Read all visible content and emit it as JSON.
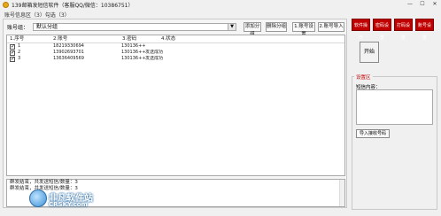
{
  "window": {
    "title": "139邮箱发短信软件（客服QQ/微信：10386751）",
    "controls": {
      "minimize": "—",
      "maximize": "☐",
      "close": "✕"
    }
  },
  "account_info": "账号信息区（3）勾选（3）",
  "account_toolbar": {
    "label": "账号组：",
    "selected_group": "默认分组",
    "buttons": [
      "添加分组",
      "删除分组",
      "1.账号设置",
      "2.账号导入"
    ]
  },
  "table": {
    "headers": [
      "1.序号",
      "2.账号",
      "3.密码",
      "4.状态"
    ],
    "rows": [
      {
        "num": "1",
        "account": "18219330694",
        "password": "130136++",
        "status": ""
      },
      {
        "num": "2",
        "account": "13902693701",
        "password": "130136++",
        "status": "发送成功"
      },
      {
        "num": "3",
        "account": "13636409569",
        "password": "130136++",
        "status": "发送成功"
      }
    ]
  },
  "log": [
    "群发结束，共发送短信/数量：3",
    "群发结束，共发送短信/数量：3"
  ],
  "right_tabs": [
    "软件操作",
    "密码设置",
    "打码设置",
    "账号设置"
  ],
  "start_button": "开始",
  "settings": {
    "legend": "设置区",
    "content_label": "短信内容：",
    "import_button": "导入接收号码"
  },
  "watermark": {
    "cn": "非凡软件站",
    "en": "CRSKY.com"
  },
  "colors": {
    "accent_red": "#c00000"
  }
}
